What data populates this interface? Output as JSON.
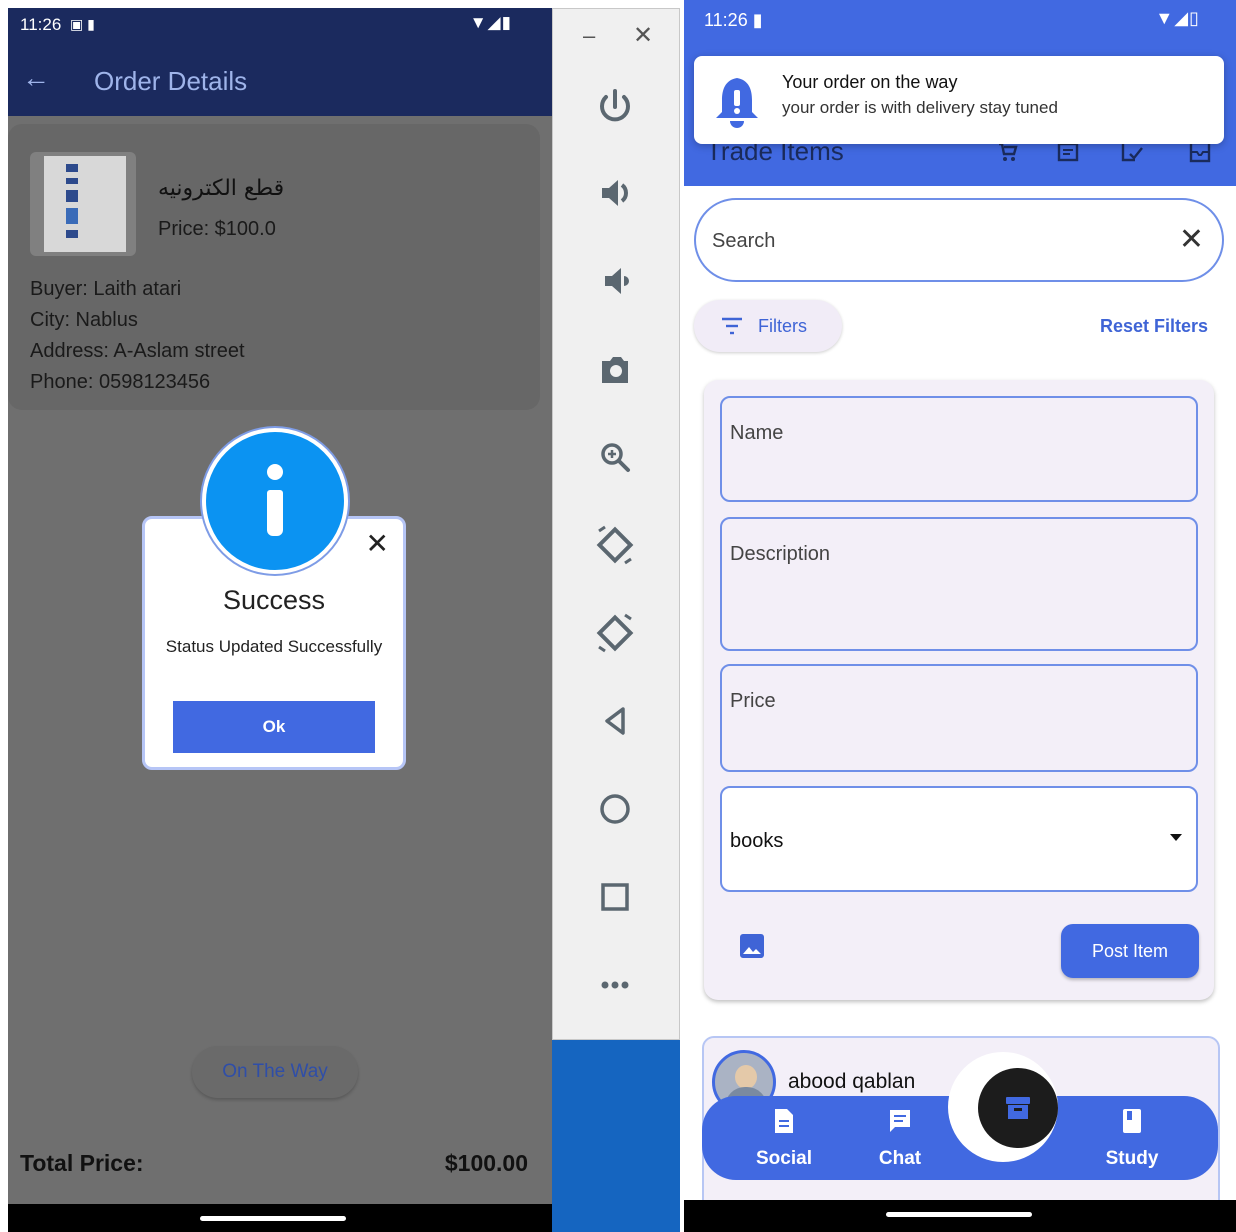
{
  "left": {
    "status": {
      "time": "11:26",
      "icons": "▣ ▮",
      "right": "▼◢▮"
    },
    "app_bar": {
      "back": "←",
      "title": "Order Details"
    },
    "order": {
      "item_name": "قطع الكترونيه",
      "price": "Price: $100.0",
      "buyer": "Buyer: Laith atari",
      "city": "City: Nablus",
      "address": "Address: A-Aslam street",
      "phone": "Phone: 0598123456"
    },
    "dialog": {
      "title": "Success",
      "message": "Status Updated Successfully",
      "ok_label": "Ok",
      "close": "✕"
    },
    "on_the_way_label": "On The Way",
    "total": {
      "label": "Total Price:",
      "value": "$100.00"
    }
  },
  "toolbar": {
    "minimize": "–",
    "close": "✕",
    "buttons": [
      "power-icon",
      "volume-up-icon",
      "volume-down-icon",
      "camera-icon",
      "zoom-icon",
      "rotate-left-icon",
      "rotate-right-icon",
      "back-icon",
      "home-icon",
      "overview-icon",
      "more-icon"
    ]
  },
  "right": {
    "status": {
      "time": "11:26 ▮",
      "right": "▼◢▯"
    },
    "notification": {
      "title": "Your order on the way",
      "body": "your order is with delivery stay tuned"
    },
    "page_title": "Trade Items",
    "search": {
      "placeholder": "Search",
      "clear": "✕"
    },
    "filters_label": "Filters",
    "reset_label": "Reset Filters",
    "form": {
      "name_placeholder": "Name",
      "description_placeholder": "Description",
      "price_placeholder": "Price",
      "category_value": "books",
      "post_label": "Post Item"
    },
    "post": {
      "author": "abood qablan"
    },
    "nav": {
      "social": "Social",
      "chat": "Chat",
      "study": "Study"
    }
  },
  "colors": {
    "primary": "#4169e1",
    "dark_blue": "#1b2a5e",
    "info": "#0b93f2"
  }
}
